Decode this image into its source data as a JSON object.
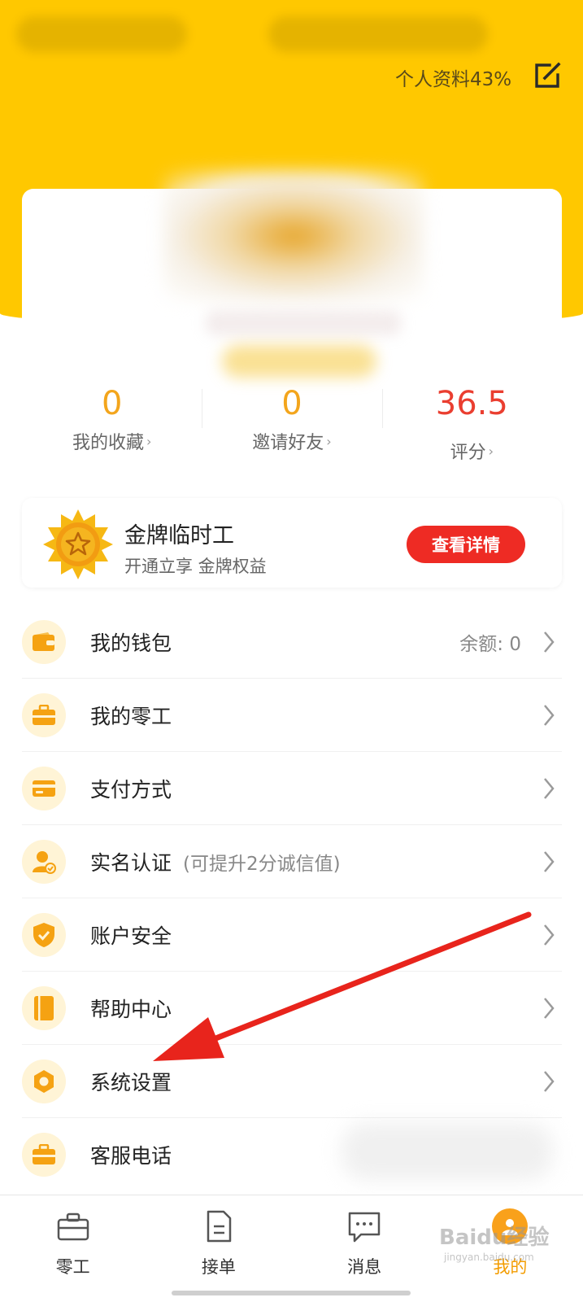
{
  "header": {
    "profile_completion": "个人资料43%",
    "edit_icon": "edit-icon"
  },
  "stats": [
    {
      "value": "0",
      "label": "我的收藏"
    },
    {
      "value": "0",
      "label": "邀请好友"
    },
    {
      "value": "36.5",
      "label": "评分"
    }
  ],
  "gold_card": {
    "title": "金牌临时工",
    "subtitle": "开通立享 金牌权益",
    "button": "查看详情"
  },
  "menu": [
    {
      "label": "我的钱包",
      "right": "余额: 0",
      "icon": "wallet-icon"
    },
    {
      "label": "我的零工",
      "icon": "briefcase-icon"
    },
    {
      "label": "支付方式",
      "icon": "card-icon"
    },
    {
      "label": "实名认证",
      "note": "(可提升2分诚信值)",
      "icon": "id-verify-icon"
    },
    {
      "label": "账户安全",
      "icon": "shield-icon"
    },
    {
      "label": "帮助中心",
      "icon": "book-icon"
    },
    {
      "label": "系统设置",
      "icon": "settings-icon"
    },
    {
      "label": "客服电话",
      "icon": "briefcase-icon"
    }
  ],
  "tabs": [
    {
      "label": "零工",
      "icon": "briefcase-icon",
      "active": false
    },
    {
      "label": "接单",
      "icon": "document-icon",
      "active": false
    },
    {
      "label": "消息",
      "icon": "chat-icon",
      "active": false
    },
    {
      "label": "我的",
      "icon": "profile-icon",
      "active": true
    }
  ],
  "watermark": {
    "main": "Baidu经验",
    "sub": "jingyan.baidu.com"
  },
  "colors": {
    "header": "#FFC800",
    "accent": "#F3A51C",
    "score": "#EA3E30",
    "button": "#EE2B24",
    "arrow": "#E8241C"
  }
}
